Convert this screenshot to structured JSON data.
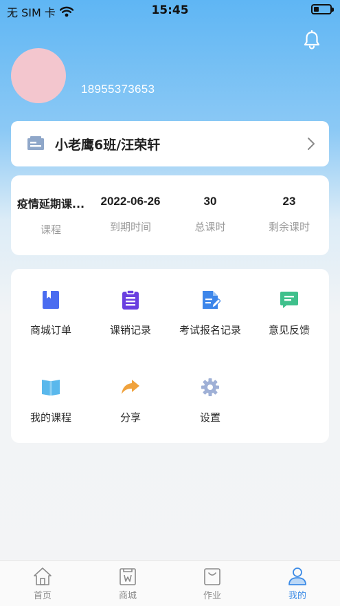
{
  "status_bar": {
    "carrier": "无 SIM 卡",
    "time": "15:45",
    "wifi_icon": "wifi-icon",
    "battery_level": 0.3
  },
  "header": {
    "phone": "18955373653",
    "bell_icon": "bell-icon",
    "avatar_color": "#f3c6ce"
  },
  "class_card": {
    "name": "小老鹰6班/汪荣轩",
    "icon": "class-board-icon",
    "chevron": "chevron-right-icon"
  },
  "stats": [
    {
      "value": "疫情延期课...",
      "label": "课程"
    },
    {
      "value": "2022-06-26",
      "label": "到期时间"
    },
    {
      "value": "30",
      "label": "总课时"
    },
    {
      "value": "23",
      "label": "剩余课时"
    }
  ],
  "menu": [
    {
      "label": "商城订单",
      "icon": "bookmark-icon",
      "color": "#4a6cf0"
    },
    {
      "label": "课销记录",
      "icon": "clipboard-icon",
      "color": "#6a3fe0"
    },
    {
      "label": "考试报名记录",
      "icon": "document-edit-icon",
      "color": "#3d86ea"
    },
    {
      "label": "意见反馈",
      "icon": "chat-bubble-icon",
      "color": "#3fc08c"
    },
    {
      "label": "我的课程",
      "icon": "open-book-icon",
      "color": "#5ab8ec"
    },
    {
      "label": "分享",
      "icon": "share-arrow-icon",
      "color": "#f0a23c"
    },
    {
      "label": "设置",
      "icon": "gear-icon",
      "color": "#9fb0d6"
    }
  ],
  "tabs": [
    {
      "label": "首页",
      "icon": "home-icon"
    },
    {
      "label": "商城",
      "icon": "shop-icon"
    },
    {
      "label": "作业",
      "icon": "bag-icon"
    },
    {
      "label": "我的",
      "icon": "user-icon",
      "active": true
    }
  ],
  "colors": {
    "accent": "#3c8be6",
    "header_gradient_top": "#5fb6f4",
    "background": "#f3f4f6"
  }
}
